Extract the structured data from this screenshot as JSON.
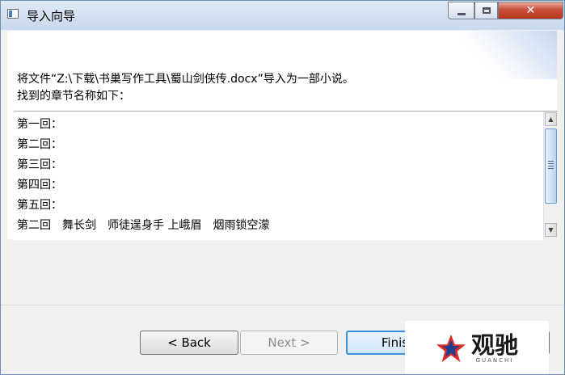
{
  "window": {
    "title": "导入向导",
    "close_symbol": "✕"
  },
  "description": {
    "line1": "将文件“Z:\\下载\\书巢写作工具\\蜀山剑侠传.docx”导入为一部小说。",
    "line2": "找到的章节名称如下："
  },
  "chapters": [
    "第一回：",
    "第二回：",
    "第三回：",
    "第四回：",
    "第五回：",
    "第二回　舞长剑　师徒逞身手 上峨眉　烟雨锁空濛"
  ],
  "buttons": {
    "back": "< Back",
    "next": "Next >",
    "finish": "Finis"
  },
  "watermark": {
    "text": "观驰",
    "subtext": "GUANCHI"
  }
}
